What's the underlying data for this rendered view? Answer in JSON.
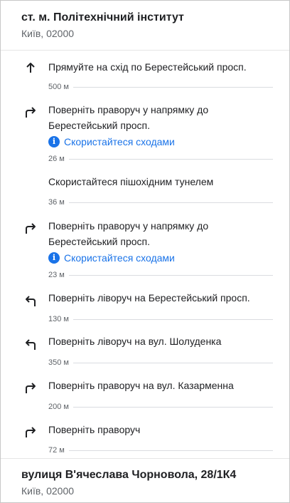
{
  "origin": {
    "name": "ст. м. Політехнічний інститут",
    "city": "Київ, 02000"
  },
  "steps": [
    {
      "icon": "arrow-up-icon",
      "text": "Прямуйте на схід по Берестейський просп.",
      "distance": "500 м"
    },
    {
      "icon": "turn-right-icon",
      "text": "Поверніть праворуч у напрямку до Берестейський просп.",
      "note": "Скористайтеся сходами",
      "distance": "26 м"
    },
    {
      "icon": "",
      "text": "Скористайтеся пішохідним тунелем",
      "distance": "36 м"
    },
    {
      "icon": "turn-right-icon",
      "text": "Поверніть праворуч у напрямку до Берестейський просп.",
      "note": "Скористайтеся сходами",
      "distance": "23 м"
    },
    {
      "icon": "turn-left-icon",
      "text": "Поверніть ліворуч на Берестейський просп.",
      "distance": "130 м"
    },
    {
      "icon": "turn-left-icon",
      "text": "Поверніть ліворуч на вул. Шолуденка",
      "distance": "350 м"
    },
    {
      "icon": "turn-right-icon",
      "text": "Поверніть праворуч на вул. Казарменна",
      "distance": "200 м"
    },
    {
      "icon": "turn-right-icon",
      "text": "Поверніть праворуч",
      "distance": "72 м"
    }
  ],
  "destination": {
    "name": "вулиця В'ячеслава Чорновола, 28/1К4",
    "city": "Київ, 02000"
  },
  "colors": {
    "accent": "#1a73e8",
    "text": "#202124",
    "secondary": "#5f6368",
    "divider": "#dadce0"
  }
}
